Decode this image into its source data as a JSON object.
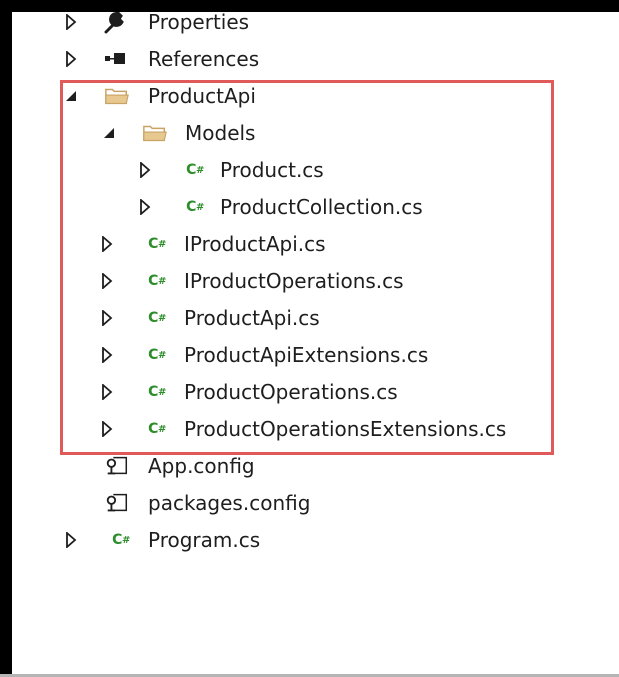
{
  "solution_explorer": {
    "items": [
      {
        "label": "Properties",
        "icon": "wrench-icon",
        "expander": "collapsed"
      },
      {
        "label": "References",
        "icon": "references-icon",
        "expander": "collapsed"
      },
      {
        "label": "ProductApi",
        "icon": "folder-open-icon",
        "expander": "expanded"
      },
      {
        "label": "Models",
        "icon": "folder-open-icon",
        "expander": "expanded"
      },
      {
        "label": "Product.cs",
        "icon": "csharp-file-icon",
        "expander": "collapsed"
      },
      {
        "label": "ProductCollection.cs",
        "icon": "csharp-file-icon",
        "expander": "collapsed"
      },
      {
        "label": "IProductApi.cs",
        "icon": "csharp-file-icon",
        "expander": "collapsed"
      },
      {
        "label": "IProductOperations.cs",
        "icon": "csharp-file-icon",
        "expander": "collapsed"
      },
      {
        "label": "ProductApi.cs",
        "icon": "csharp-file-icon",
        "expander": "collapsed"
      },
      {
        "label": "ProductApiExtensions.cs",
        "icon": "csharp-file-icon",
        "expander": "collapsed"
      },
      {
        "label": "ProductOperations.cs",
        "icon": "csharp-file-icon",
        "expander": "collapsed"
      },
      {
        "label": "ProductOperationsExtensions.cs",
        "icon": "csharp-file-icon",
        "expander": "collapsed"
      },
      {
        "label": "App.config",
        "icon": "config-file-icon",
        "expander": "none"
      },
      {
        "label": "packages.config",
        "icon": "config-file-icon",
        "expander": "none"
      },
      {
        "label": "Program.cs",
        "icon": "csharp-file-icon",
        "expander": "collapsed"
      }
    ],
    "csharp_icon_text": "C",
    "csharp_icon_hash": "#"
  },
  "colors": {
    "highlight_border": "#e05a5a",
    "csharp_icon": "#2c8d2a",
    "folder": "#d9b77a",
    "text": "#1e1e1e"
  }
}
